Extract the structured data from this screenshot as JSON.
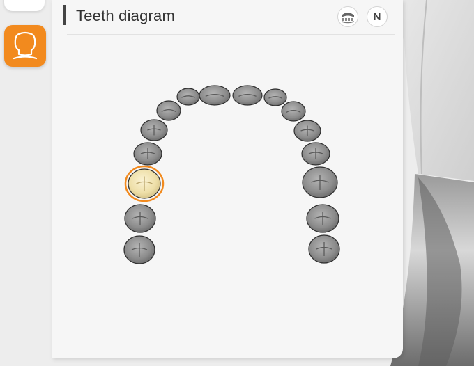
{
  "panel": {
    "title": "Teeth diagram",
    "numbering_icon_letter": "N"
  },
  "icons": {
    "left_toolbar_top": "tool-icon",
    "left_toolbar_active": "tooth-crown-icon",
    "jaw_toggle": "jaw-icon",
    "numbering_system": "numbering-icon"
  },
  "colors": {
    "accent_orange": "#f28a1e",
    "selected_tooth_fill": "#f2e3b0",
    "tooth_gray": "#8a8a8a"
  },
  "teeth": [
    {
      "id": "upper-right-molar-3",
      "selected": false
    },
    {
      "id": "upper-right-molar-2",
      "selected": false
    },
    {
      "id": "upper-right-molar-1",
      "selected": true
    },
    {
      "id": "upper-right-premolar-2",
      "selected": false
    },
    {
      "id": "upper-right-premolar-1",
      "selected": false
    },
    {
      "id": "upper-right-canine",
      "selected": false
    },
    {
      "id": "upper-right-lateral-incisor",
      "selected": false
    },
    {
      "id": "upper-right-central-incisor",
      "selected": false
    },
    {
      "id": "upper-left-central-incisor",
      "selected": false
    },
    {
      "id": "upper-left-lateral-incisor",
      "selected": false
    },
    {
      "id": "upper-left-canine",
      "selected": false
    },
    {
      "id": "upper-left-premolar-1",
      "selected": false
    },
    {
      "id": "upper-left-premolar-2",
      "selected": false
    },
    {
      "id": "upper-left-molar-1",
      "selected": false
    },
    {
      "id": "upper-left-molar-2",
      "selected": false
    },
    {
      "id": "upper-left-molar-3",
      "selected": false
    }
  ]
}
